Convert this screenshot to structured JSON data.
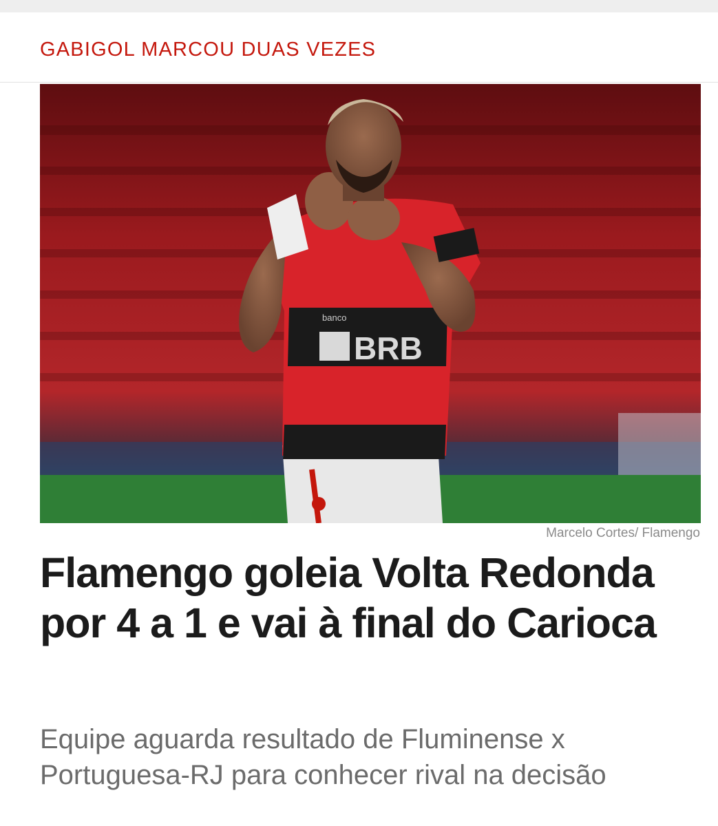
{
  "article": {
    "kicker": "GABIGOL MARCOU DUAS VEZES",
    "photo": {
      "credit": "Marcelo Cortes/ Flamengo",
      "sponsor_text": "BRB",
      "sponsor_small": "banco"
    },
    "headline": "Flamengo goleia Volta Redonda por 4 a 1 e vai à final do Carioca",
    "subtitle": "Equipe aguarda resultado de Fluminense x Portuguesa-RJ para conhecer rival na decisão"
  },
  "colors": {
    "kicker": "#c4170c",
    "headline": "#1b1b1b",
    "subtitle": "#6b6b6b",
    "credit": "#8a8a8a",
    "jersey_red": "#d8232a",
    "jersey_black": "#1a1a1a"
  }
}
